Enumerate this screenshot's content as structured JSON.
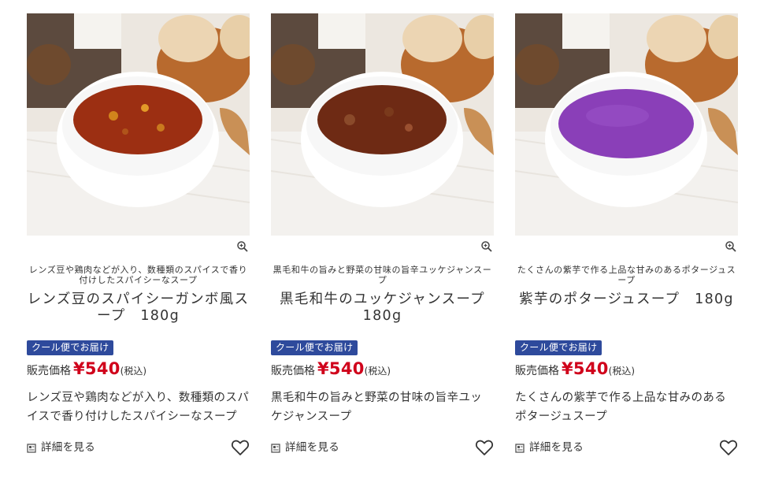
{
  "products": [
    {
      "catch_copy": "レンズ豆や鶏肉などが入り、数種類のスパイスで香り付けしたスパイシーなスープ",
      "name": "レンズ豆のスパイシーガンボ風スープ　180g",
      "badge": "クール便でお届け",
      "price_label": "販売価格",
      "price": "¥540",
      "tax_note": "(税込)",
      "description": "レンズ豆や鶏肉などが入り、数種類のスパイスで香り付けしたスパイシーなスープ",
      "detail_link": "詳細を見る",
      "soup_color": "#9c2f12"
    },
    {
      "catch_copy": "黒毛和牛の旨みと野菜の甘味の旨辛ユッケジャンスープ",
      "name": "黒毛和牛のユッケジャンスープ　180g",
      "badge": "クール便でお届け",
      "price_label": "販売価格",
      "price": "¥540",
      "tax_note": "(税込)",
      "description": "黒毛和牛の旨みと野菜の甘味の旨辛ユッケジャンスープ",
      "detail_link": "詳細を見る",
      "soup_color": "#6e2a14"
    },
    {
      "catch_copy": "たくさんの紫芋で作る上品な甘みのあるポタージュスープ",
      "name": "紫芋のポタージュスープ　180g",
      "badge": "クール便でお届け",
      "price_label": "販売価格",
      "price": "¥540",
      "tax_note": "(税込)",
      "description": "たくさんの紫芋で作る上品な甘みのあるポタージュスープ",
      "detail_link": "詳細を見る",
      "soup_color": "#8a3fb8"
    }
  ],
  "icons": {
    "zoom": "magnifier-plus-icon",
    "detail": "document-icon",
    "favorite": "heart-outline-icon"
  },
  "colors": {
    "badge_bg": "#2e4a9c",
    "price": "#d0021b",
    "text": "#333333"
  }
}
